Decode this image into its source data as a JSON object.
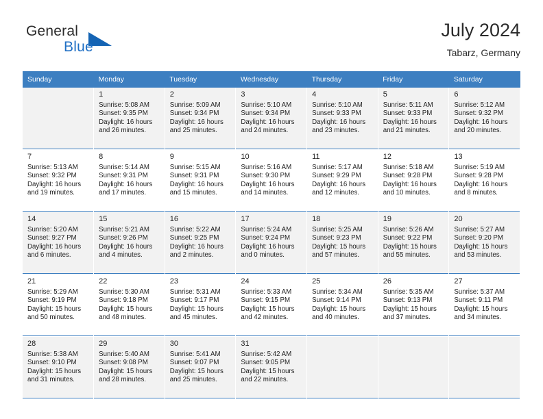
{
  "brand": {
    "word_one": "General",
    "word_two": "Blue",
    "accent_color": "#1464b4",
    "triangle_icon": "brand-triangle-icon"
  },
  "header": {
    "title": "July 2024",
    "subtitle": "Tabarz, Germany"
  },
  "theme": {
    "header_row_bg": "#3d7fc1",
    "header_row_text": "#ffffff",
    "shaded_row_bg": "#f2f2f2",
    "cell_bg": "#ffffff",
    "cell_rule": "#3d7fc1",
    "text": "#222222"
  },
  "weekdays": [
    "Sunday",
    "Monday",
    "Tuesday",
    "Wednesday",
    "Thursday",
    "Friday",
    "Saturday"
  ],
  "weeks": [
    {
      "shaded": true,
      "days": [
        {
          "day": "",
          "info": "",
          "empty": true
        },
        {
          "day": "1",
          "info": "Sunrise: 5:08 AM\nSunset: 9:35 PM\nDaylight: 16 hours\nand 26 minutes."
        },
        {
          "day": "2",
          "info": "Sunrise: 5:09 AM\nSunset: 9:34 PM\nDaylight: 16 hours\nand 25 minutes."
        },
        {
          "day": "3",
          "info": "Sunrise: 5:10 AM\nSunset: 9:34 PM\nDaylight: 16 hours\nand 24 minutes."
        },
        {
          "day": "4",
          "info": "Sunrise: 5:10 AM\nSunset: 9:33 PM\nDaylight: 16 hours\nand 23 minutes."
        },
        {
          "day": "5",
          "info": "Sunrise: 5:11 AM\nSunset: 9:33 PM\nDaylight: 16 hours\nand 21 minutes."
        },
        {
          "day": "6",
          "info": "Sunrise: 5:12 AM\nSunset: 9:32 PM\nDaylight: 16 hours\nand 20 minutes."
        }
      ]
    },
    {
      "shaded": false,
      "days": [
        {
          "day": "7",
          "info": "Sunrise: 5:13 AM\nSunset: 9:32 PM\nDaylight: 16 hours\nand 19 minutes."
        },
        {
          "day": "8",
          "info": "Sunrise: 5:14 AM\nSunset: 9:31 PM\nDaylight: 16 hours\nand 17 minutes."
        },
        {
          "day": "9",
          "info": "Sunrise: 5:15 AM\nSunset: 9:31 PM\nDaylight: 16 hours\nand 15 minutes."
        },
        {
          "day": "10",
          "info": "Sunrise: 5:16 AM\nSunset: 9:30 PM\nDaylight: 16 hours\nand 14 minutes."
        },
        {
          "day": "11",
          "info": "Sunrise: 5:17 AM\nSunset: 9:29 PM\nDaylight: 16 hours\nand 12 minutes."
        },
        {
          "day": "12",
          "info": "Sunrise: 5:18 AM\nSunset: 9:28 PM\nDaylight: 16 hours\nand 10 minutes."
        },
        {
          "day": "13",
          "info": "Sunrise: 5:19 AM\nSunset: 9:28 PM\nDaylight: 16 hours\nand 8 minutes."
        }
      ]
    },
    {
      "shaded": true,
      "days": [
        {
          "day": "14",
          "info": "Sunrise: 5:20 AM\nSunset: 9:27 PM\nDaylight: 16 hours\nand 6 minutes."
        },
        {
          "day": "15",
          "info": "Sunrise: 5:21 AM\nSunset: 9:26 PM\nDaylight: 16 hours\nand 4 minutes."
        },
        {
          "day": "16",
          "info": "Sunrise: 5:22 AM\nSunset: 9:25 PM\nDaylight: 16 hours\nand 2 minutes."
        },
        {
          "day": "17",
          "info": "Sunrise: 5:24 AM\nSunset: 9:24 PM\nDaylight: 16 hours\nand 0 minutes."
        },
        {
          "day": "18",
          "info": "Sunrise: 5:25 AM\nSunset: 9:23 PM\nDaylight: 15 hours\nand 57 minutes."
        },
        {
          "day": "19",
          "info": "Sunrise: 5:26 AM\nSunset: 9:22 PM\nDaylight: 15 hours\nand 55 minutes."
        },
        {
          "day": "20",
          "info": "Sunrise: 5:27 AM\nSunset: 9:20 PM\nDaylight: 15 hours\nand 53 minutes."
        }
      ]
    },
    {
      "shaded": false,
      "days": [
        {
          "day": "21",
          "info": "Sunrise: 5:29 AM\nSunset: 9:19 PM\nDaylight: 15 hours\nand 50 minutes."
        },
        {
          "day": "22",
          "info": "Sunrise: 5:30 AM\nSunset: 9:18 PM\nDaylight: 15 hours\nand 48 minutes."
        },
        {
          "day": "23",
          "info": "Sunrise: 5:31 AM\nSunset: 9:17 PM\nDaylight: 15 hours\nand 45 minutes."
        },
        {
          "day": "24",
          "info": "Sunrise: 5:33 AM\nSunset: 9:15 PM\nDaylight: 15 hours\nand 42 minutes."
        },
        {
          "day": "25",
          "info": "Sunrise: 5:34 AM\nSunset: 9:14 PM\nDaylight: 15 hours\nand 40 minutes."
        },
        {
          "day": "26",
          "info": "Sunrise: 5:35 AM\nSunset: 9:13 PM\nDaylight: 15 hours\nand 37 minutes."
        },
        {
          "day": "27",
          "info": "Sunrise: 5:37 AM\nSunset: 9:11 PM\nDaylight: 15 hours\nand 34 minutes."
        }
      ]
    },
    {
      "shaded": true,
      "days": [
        {
          "day": "28",
          "info": "Sunrise: 5:38 AM\nSunset: 9:10 PM\nDaylight: 15 hours\nand 31 minutes."
        },
        {
          "day": "29",
          "info": "Sunrise: 5:40 AM\nSunset: 9:08 PM\nDaylight: 15 hours\nand 28 minutes."
        },
        {
          "day": "30",
          "info": "Sunrise: 5:41 AM\nSunset: 9:07 PM\nDaylight: 15 hours\nand 25 minutes."
        },
        {
          "day": "31",
          "info": "Sunrise: 5:42 AM\nSunset: 9:05 PM\nDaylight: 15 hours\nand 22 minutes."
        },
        {
          "day": "",
          "info": "",
          "empty": true
        },
        {
          "day": "",
          "info": "",
          "empty": true
        },
        {
          "day": "",
          "info": "",
          "empty": true
        }
      ]
    }
  ]
}
